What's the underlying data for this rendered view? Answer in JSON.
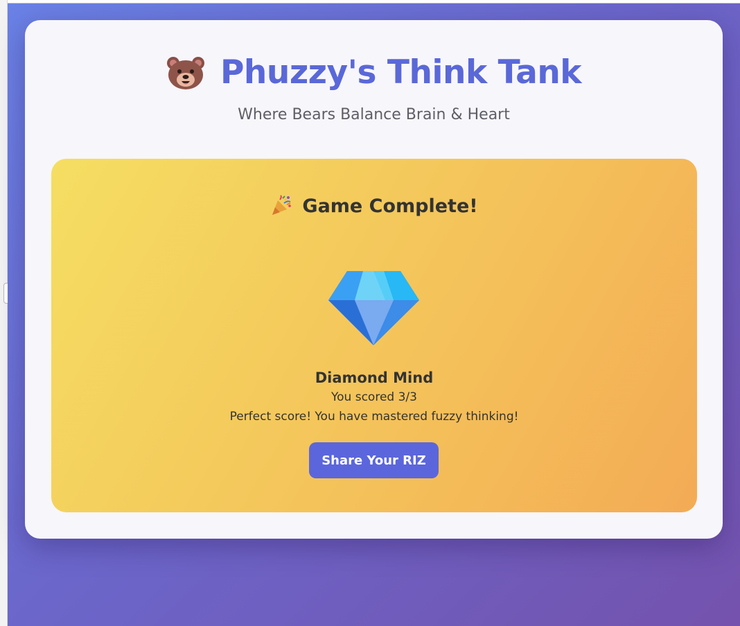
{
  "app": {
    "title": "Phuzzy's Think Tank",
    "subtitle": "Where Bears Balance Brain & Heart",
    "logo_icon": "bear-face-icon"
  },
  "result": {
    "heading": "Game Complete!",
    "heading_icon": "party-popper-icon",
    "rank_icon": "gem-icon",
    "rank_name": "Diamond Mind",
    "score_text": "You scored 3/3",
    "message": "Perfect score! You have mastered fuzzy thinking!",
    "share_label": "Share Your RIZ"
  },
  "colors": {
    "background_gradient": [
      "#6a82e6",
      "#7452ad"
    ],
    "card": "#f7f6fb",
    "title": "#5a68d8",
    "panel_gradient": [
      "#f5de62",
      "#f3ab55"
    ],
    "button": "#5b66dc",
    "button_text": "#ffffff"
  }
}
